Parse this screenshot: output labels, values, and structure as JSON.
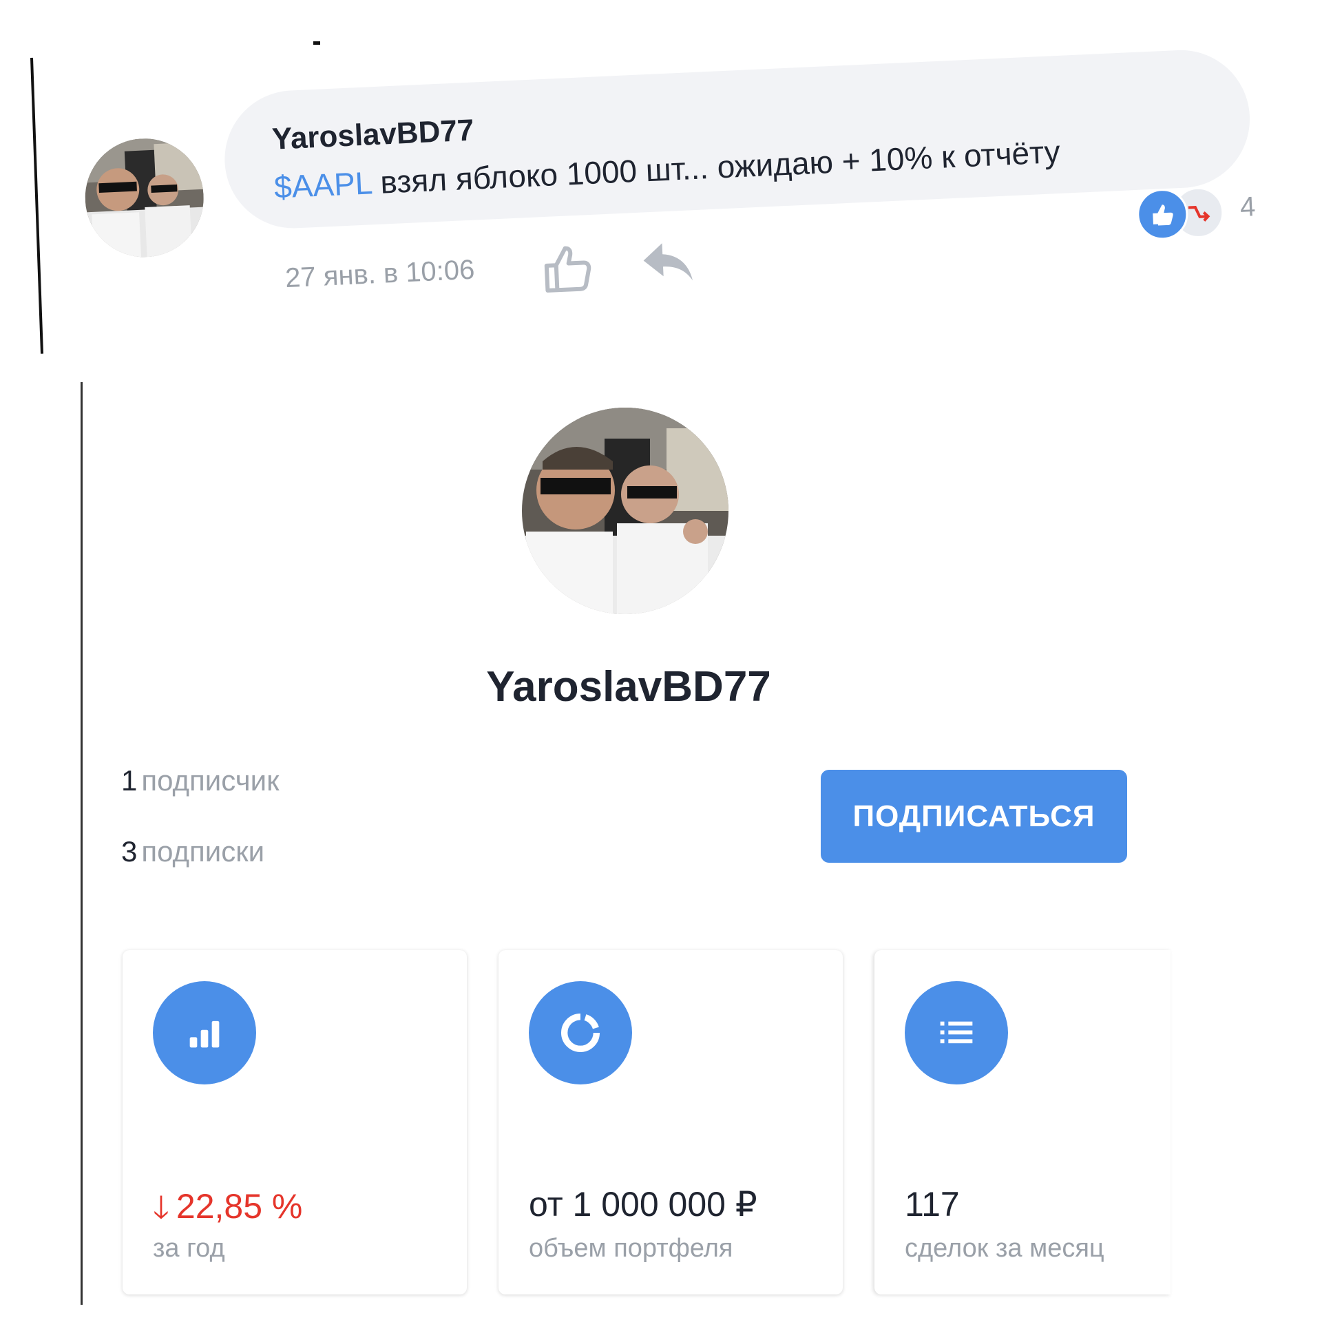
{
  "comment": {
    "author": "YaroslavBD77",
    "ticker": "$AAPL",
    "text": " взял яблоко 1000 шт... ожидаю + 10% к отчёту",
    "timestamp": "27 янв. в 10:06",
    "reaction_count": "4",
    "icons": [
      "avatar",
      "like-icon",
      "reply-icon",
      "like-reaction-icon",
      "down-trend-reaction-icon"
    ]
  },
  "profile": {
    "name": "YaroslavBD77",
    "followers_count": "1",
    "followers_label": "подписчик",
    "following_count": "3",
    "following_label": "подписки",
    "subscribe_label": "ПОДПИСАТЬСЯ"
  },
  "cards": [
    {
      "icon": "bar-chart-icon",
      "arrow": "🡓",
      "value": "22,85 %",
      "label": "за год",
      "value_color": "#e5352b"
    },
    {
      "icon": "donut-chart-icon",
      "value": "от 1 000 000 ₽",
      "label": "объем портфеля"
    },
    {
      "icon": "list-icon",
      "value": "117",
      "label": "сделок за месяц"
    }
  ],
  "colors": {
    "accent": "#4b8fe8",
    "negative": "#e5352b",
    "muted_text": "#9aa0a8",
    "bubble_bg": "#f2f3f6"
  }
}
